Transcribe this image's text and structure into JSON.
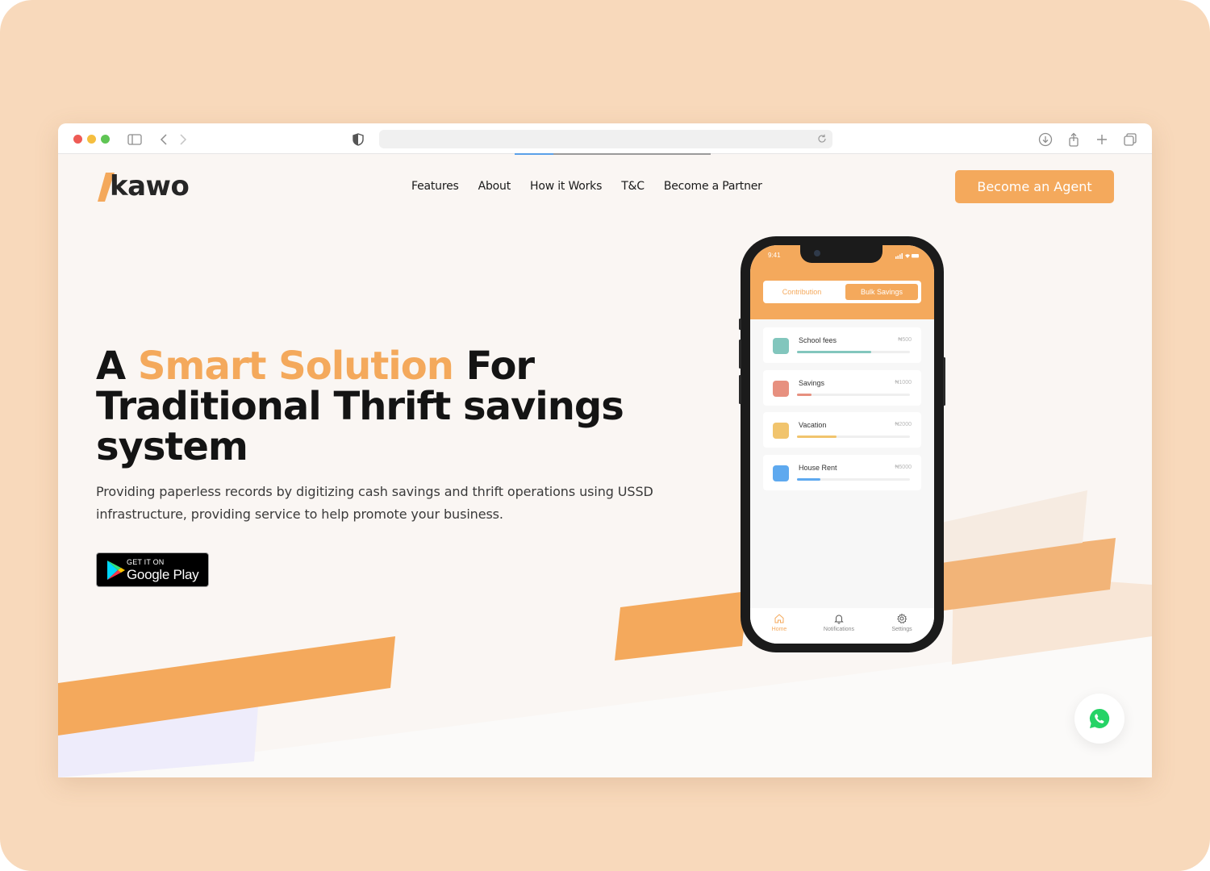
{
  "browser": {
    "url": "",
    "icons": [
      "sidebar-icon",
      "back-icon",
      "forward-icon",
      "shield-icon",
      "reload-icon",
      "download-icon",
      "share-icon",
      "new-tab-icon",
      "tabs-overview-icon"
    ]
  },
  "nav": {
    "logo_text": "kawo",
    "links": [
      "Features",
      "About",
      "How it Works",
      "T&C",
      "Become a Partner"
    ],
    "cta": "Become an Agent"
  },
  "hero": {
    "title_prefix": "A ",
    "title_accent": "Smart Solution",
    "title_rest": " For Traditional Thrift savings system",
    "subtitle": "Providing paperless records by digitizing cash savings and thrift operations using USSD infrastructure, providing service to help promote your business.",
    "store_badge": {
      "small": "GET IT ON",
      "big": "Google Play"
    }
  },
  "phone": {
    "time": "9:41",
    "tabs": [
      "Contribution",
      "Bulk Savings"
    ],
    "active_tab": "Bulk Savings",
    "goals": [
      {
        "name": "School fees",
        "amount": "₦500",
        "progress": 0.66,
        "color": "#82c6bd"
      },
      {
        "name": "Savings",
        "amount": "₦1000",
        "progress": 0.13,
        "color": "#e7907f"
      },
      {
        "name": "Vacation",
        "amount": "₦2000",
        "progress": 0.35,
        "color": "#f1c46d"
      },
      {
        "name": "House Rent",
        "amount": "₦5000",
        "progress": 0.21,
        "color": "#5ea9ef"
      }
    ],
    "bottom_nav": [
      {
        "label": "Home",
        "icon": "home-icon",
        "active": true
      },
      {
        "label": "Notifications",
        "icon": "bell-icon",
        "active": false
      },
      {
        "label": "Settings",
        "icon": "gear-icon",
        "active": false
      }
    ]
  },
  "colors": {
    "accent": "#f4a95c",
    "frame": "#f8d9bb",
    "page": "#faf6f3",
    "whatsapp": "#25d366"
  },
  "fab": {
    "icon": "whatsapp-icon"
  }
}
